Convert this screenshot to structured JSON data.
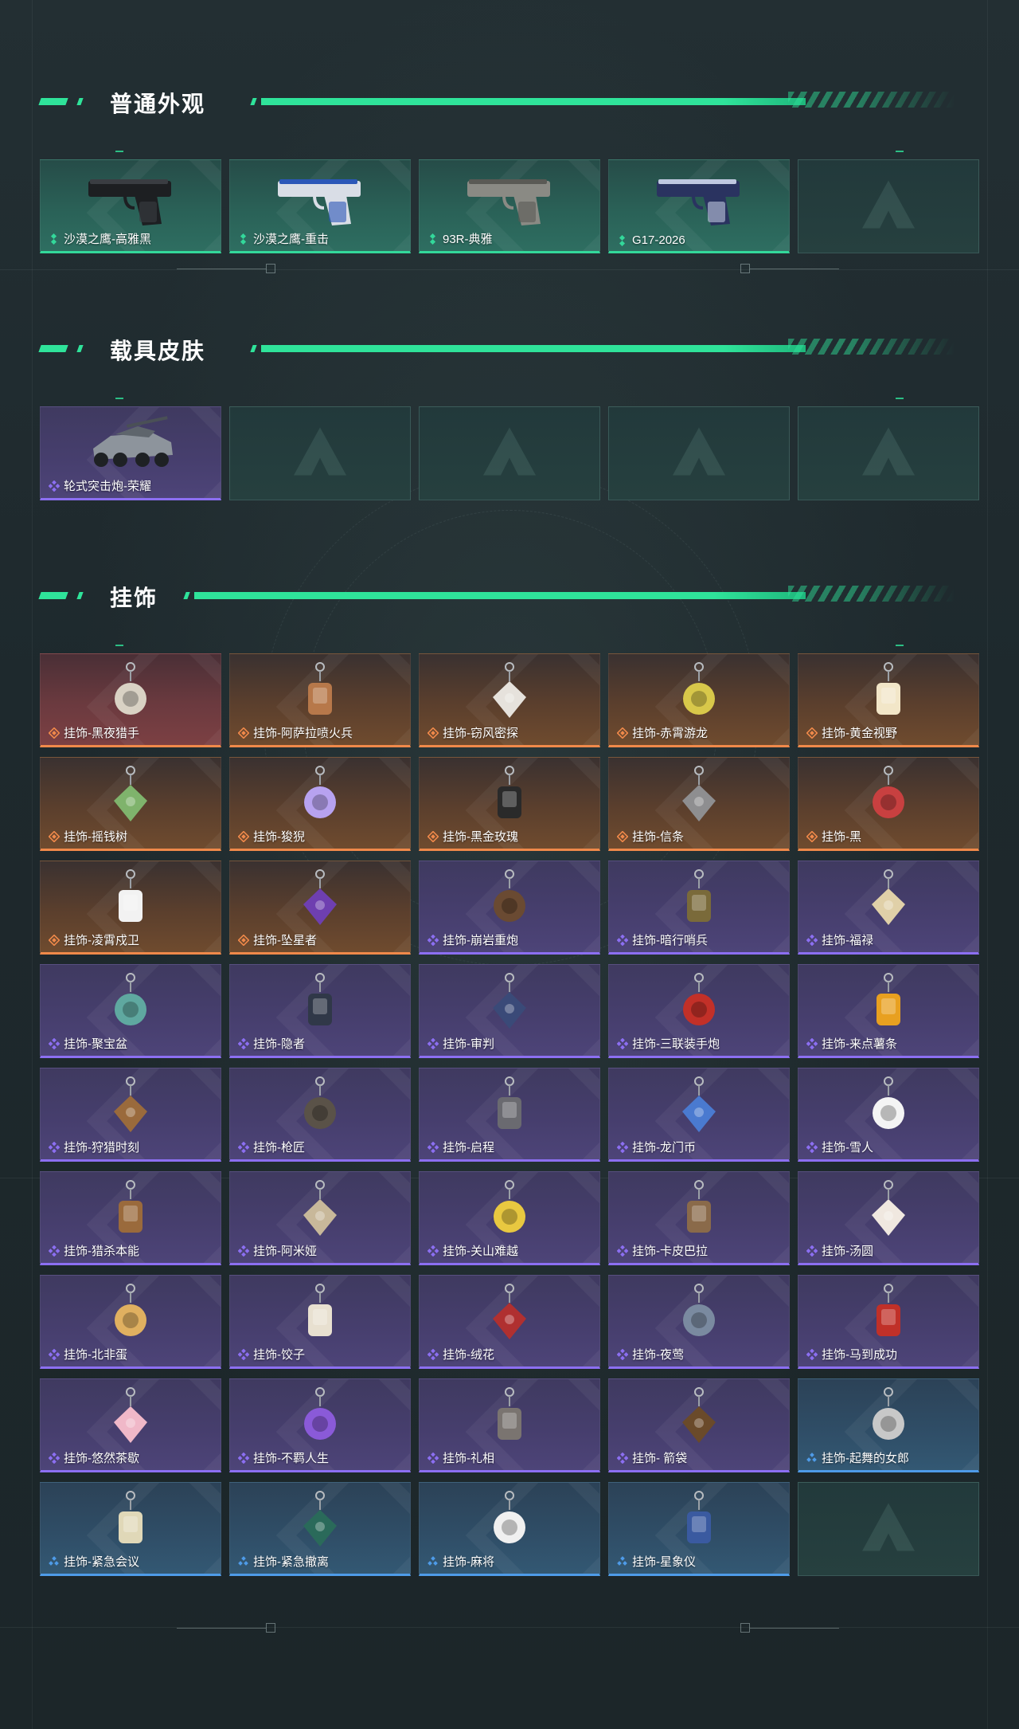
{
  "colors": {
    "accent": "#2fe39a",
    "green": "#33d89a",
    "purple": "#8c6ff2",
    "orange": "#f0894a",
    "blue": "#4e9be8"
  },
  "sections": [
    {
      "title": "普通外观",
      "cols": 5,
      "items": [
        {
          "label": "沙漠之鹰-高雅黑",
          "rarity": "green",
          "icon": "pistol-icon"
        },
        {
          "label": "沙漠之鹰-重击",
          "rarity": "green",
          "icon": "pistol-icon"
        },
        {
          "label": "93R-典雅",
          "rarity": "green",
          "icon": "pistol-icon"
        },
        {
          "label": "G17-2026",
          "rarity": "green",
          "icon": "pistol-icon"
        },
        {
          "label": "",
          "rarity": "empty",
          "icon": "empty-slot-icon"
        }
      ]
    },
    {
      "title": "载具皮肤",
      "cols": 5,
      "items": [
        {
          "label": "轮式突击炮-荣耀",
          "rarity": "purple",
          "icon": "vehicle-icon"
        },
        {
          "label": "",
          "rarity": "empty",
          "icon": "empty-slot-icon"
        },
        {
          "label": "",
          "rarity": "empty",
          "icon": "empty-slot-icon"
        },
        {
          "label": "",
          "rarity": "empty",
          "icon": "empty-slot-icon"
        },
        {
          "label": "",
          "rarity": "empty",
          "icon": "empty-slot-icon"
        }
      ]
    },
    {
      "title": "挂饰",
      "cols": 5,
      "items": [
        {
          "label": "挂饰-黑夜猎手",
          "rarity": "red",
          "icon": "charm-icon"
        },
        {
          "label": "挂饰-阿萨拉喷火兵",
          "rarity": "orange",
          "icon": "charm-icon"
        },
        {
          "label": "挂饰-窃风密探",
          "rarity": "orange",
          "icon": "charm-icon"
        },
        {
          "label": "挂饰-赤霄游龙",
          "rarity": "orange",
          "icon": "charm-icon"
        },
        {
          "label": "挂饰-黄金视野",
          "rarity": "orange",
          "icon": "charm-icon"
        },
        {
          "label": "挂饰-摇钱树",
          "rarity": "orange",
          "icon": "charm-icon"
        },
        {
          "label": "挂饰-狻猊",
          "rarity": "orange",
          "icon": "charm-icon"
        },
        {
          "label": "挂饰-黑金玫瑰",
          "rarity": "orange",
          "icon": "charm-icon"
        },
        {
          "label": "挂饰-信条",
          "rarity": "orange",
          "icon": "charm-icon"
        },
        {
          "label": "挂饰-黑",
          "rarity": "orange",
          "icon": "charm-icon"
        },
        {
          "label": "挂饰-凌霄戍卫",
          "rarity": "orange",
          "icon": "charm-icon"
        },
        {
          "label": "挂饰-坠星者",
          "rarity": "orange",
          "icon": "charm-icon"
        },
        {
          "label": "挂饰-崩岩重炮",
          "rarity": "purple",
          "icon": "charm-icon"
        },
        {
          "label": "挂饰-暗行哨兵",
          "rarity": "purple",
          "icon": "charm-icon"
        },
        {
          "label": "挂饰-福禄",
          "rarity": "purple",
          "icon": "charm-icon"
        },
        {
          "label": "挂饰-聚宝盆",
          "rarity": "purple",
          "icon": "charm-icon"
        },
        {
          "label": "挂饰-隐者",
          "rarity": "purple",
          "icon": "charm-icon"
        },
        {
          "label": "挂饰-审判",
          "rarity": "purple",
          "icon": "charm-icon"
        },
        {
          "label": "挂饰-三联装手炮",
          "rarity": "purple",
          "icon": "charm-icon"
        },
        {
          "label": "挂饰-来点薯条",
          "rarity": "purple",
          "icon": "charm-icon"
        },
        {
          "label": "挂饰-狩猎时刻",
          "rarity": "purple",
          "icon": "charm-icon"
        },
        {
          "label": "挂饰-枪匠",
          "rarity": "purple",
          "icon": "charm-icon"
        },
        {
          "label": "挂饰-启程",
          "rarity": "purple",
          "icon": "charm-icon"
        },
        {
          "label": "挂饰-龙门币",
          "rarity": "purple",
          "icon": "charm-icon"
        },
        {
          "label": "挂饰-雪人",
          "rarity": "purple",
          "icon": "charm-icon"
        },
        {
          "label": "挂饰-猎杀本能",
          "rarity": "purple",
          "icon": "charm-icon"
        },
        {
          "label": "挂饰-阿米娅",
          "rarity": "purple",
          "icon": "charm-icon"
        },
        {
          "label": "挂饰-关山难越",
          "rarity": "purple",
          "icon": "charm-icon"
        },
        {
          "label": "挂饰-卡皮巴拉",
          "rarity": "purple",
          "icon": "charm-icon"
        },
        {
          "label": "挂饰-汤圆",
          "rarity": "purple",
          "icon": "charm-icon"
        },
        {
          "label": "挂饰-北非蛋",
          "rarity": "purple",
          "icon": "charm-icon"
        },
        {
          "label": "挂饰-饺子",
          "rarity": "purple",
          "icon": "charm-icon"
        },
        {
          "label": "挂饰-绒花",
          "rarity": "purple",
          "icon": "charm-icon"
        },
        {
          "label": "挂饰-夜莺",
          "rarity": "purple",
          "icon": "charm-icon"
        },
        {
          "label": "挂饰-马到成功",
          "rarity": "purple",
          "icon": "charm-icon"
        },
        {
          "label": "挂饰-悠然茶歇",
          "rarity": "purple",
          "icon": "charm-icon"
        },
        {
          "label": "挂饰-不羁人生",
          "rarity": "purple",
          "icon": "charm-icon"
        },
        {
          "label": "挂饰-礼相",
          "rarity": "purple",
          "icon": "charm-icon"
        },
        {
          "label": "挂饰- 箭袋",
          "rarity": "purple",
          "icon": "charm-icon"
        },
        {
          "label": "挂饰-起舞的女郎",
          "rarity": "blue",
          "icon": "charm-icon"
        },
        {
          "label": "挂饰-紧急会议",
          "rarity": "blue",
          "icon": "charm-icon"
        },
        {
          "label": "挂饰-紧急撤离",
          "rarity": "blue",
          "icon": "charm-icon"
        },
        {
          "label": "挂饰-麻将",
          "rarity": "blue",
          "icon": "charm-icon"
        },
        {
          "label": "挂饰-星象仪",
          "rarity": "blue",
          "icon": "charm-icon"
        },
        {
          "label": "",
          "rarity": "empty",
          "icon": "empty-slot-icon"
        }
      ]
    }
  ]
}
